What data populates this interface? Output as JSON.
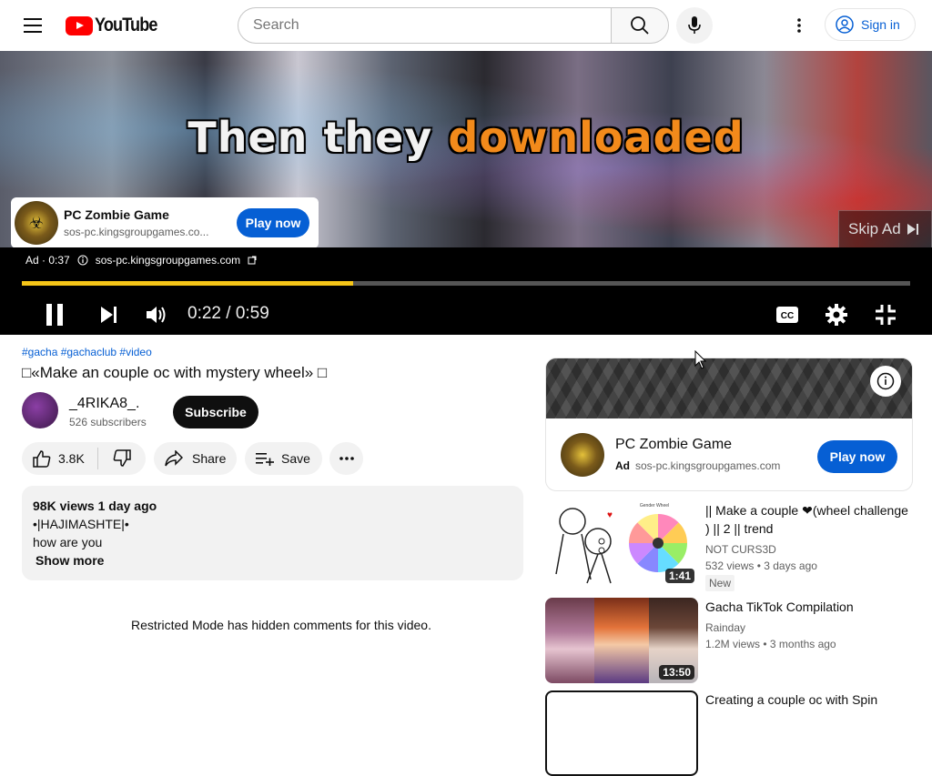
{
  "header": {
    "logo_text": "YouTube",
    "search_placeholder": "Search",
    "sign_in": "Sign in"
  },
  "player": {
    "caption_part1": "Then they ",
    "caption_part2": "downloaded",
    "ad_card": {
      "name": "PC Zombie Game",
      "url": "sos-pc.kingsgroupgames.co...",
      "cta": "Play now"
    },
    "skip_ad": "Skip Ad",
    "ad_label": "Ad · 0:37",
    "ad_domain": "sos-pc.kingsgroupgames.com",
    "progress_fraction": 0.373,
    "time": "0:22 / 0:59"
  },
  "video": {
    "tags": "#gacha #gachaclub #video",
    "title": "□«Make an couple oc with mystery wheel» □",
    "channel_name": "_4RIKA8_.",
    "subscribers": "526 subscribers",
    "subscribe": "Subscribe",
    "likes": "3.8K",
    "share": "Share",
    "save": "Save",
    "views_date": "98K views  1 day ago",
    "desc_line1": "•|HAJIMASHTE|•",
    "desc_line2": "how are you",
    "show_more": "Show more",
    "restricted": "Restricted Mode has hidden comments for this video."
  },
  "side_ad": {
    "name": "PC Zombie Game",
    "ad_badge": "Ad",
    "url": "sos-pc.kingsgroupgames.com",
    "cta": "Play now"
  },
  "recommendations": [
    {
      "title": "|| Make a couple ❤(wheel challenge ) || 2 || trend",
      "channel": "NOT CURS3D",
      "meta": "532 views  • 3 days ago",
      "badge": "New",
      "duration": "1:41"
    },
    {
      "title": "Gacha TikTok Compilation",
      "channel": "Rainday",
      "meta": "1.2M views  • 3 months ago",
      "duration": "13:50"
    },
    {
      "title": "Creating a couple oc with Spin"
    }
  ],
  "colors": {
    "accent": "#065fd4",
    "progress": "#f5c518",
    "logo_red": "#ff0000"
  }
}
